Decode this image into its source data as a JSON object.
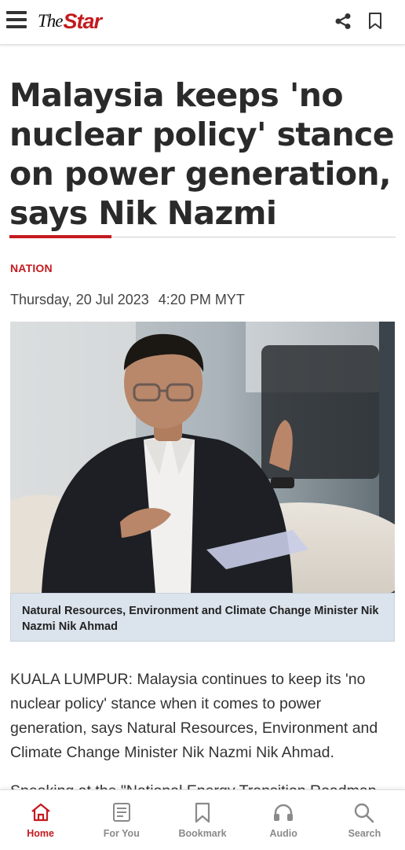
{
  "header": {
    "menu_icon": "hamburger-menu-icon",
    "logo_the": "The",
    "logo_star": "Star",
    "share_icon": "share-icon",
    "bookmark_icon": "bookmark-icon"
  },
  "article": {
    "headline": "Malaysia keeps 'no nuclear policy' stance on power generation, says Nik Nazmi",
    "category": "NATION",
    "date": "Thursday, 20 Jul 2023",
    "time": "4:20 PM MYT",
    "caption": "Natural Resources, Environment and Climate Change Minister Nik Nazmi Nik Ahmad",
    "paragraph_1": "KUALA LUMPUR: Malaysia continues to keep its 'no nuclear policy' stance when it comes to power generation, says Natural Resources, Environment and Climate Change Minister Nik Nazmi Nik Ahmad.",
    "paragraph_2": "Speaking at the \"National Energy Transition Roadmap"
  },
  "bottom_nav": [
    {
      "label": "Home",
      "icon": "home-icon",
      "active": true
    },
    {
      "label": "For You",
      "icon": "news-feed-icon",
      "active": false
    },
    {
      "label": "Bookmark",
      "icon": "bookmark-icon",
      "active": false
    },
    {
      "label": "Audio",
      "icon": "headphones-icon",
      "active": false
    },
    {
      "label": "Search",
      "icon": "search-icon",
      "active": false
    }
  ],
  "colors": {
    "brand_red": "#c41a1f",
    "caption_bg": "#dbe3ec",
    "nav_inactive": "#8a8a8a"
  }
}
